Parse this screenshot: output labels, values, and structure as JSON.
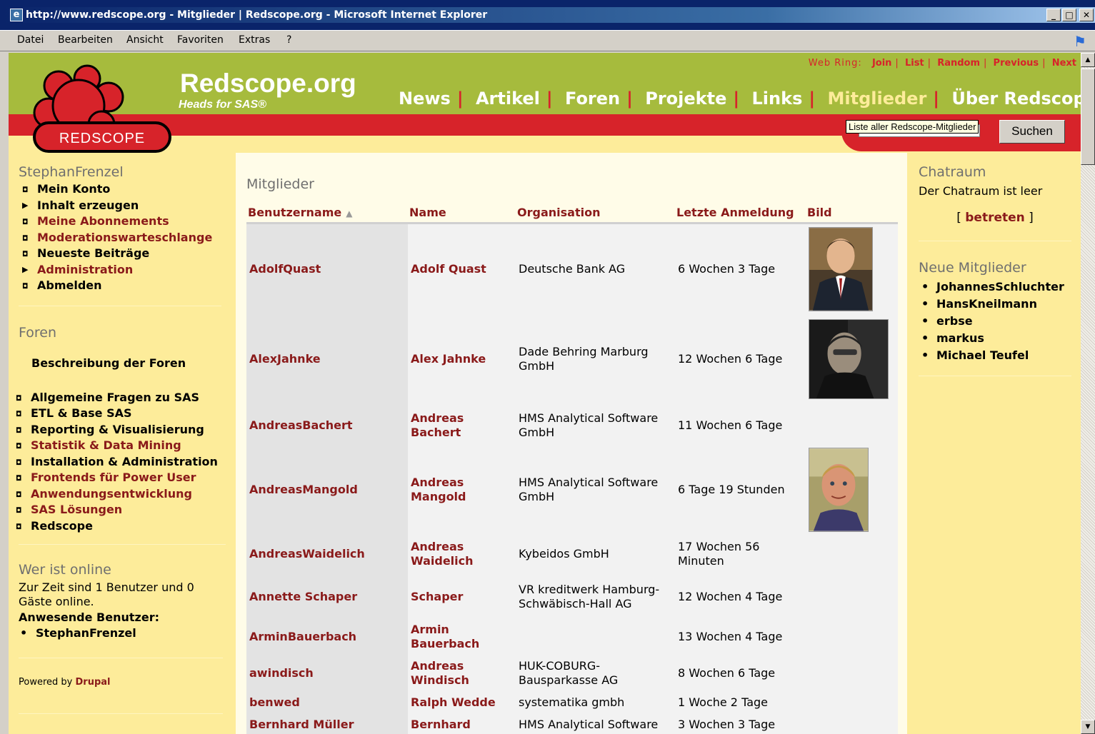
{
  "window": {
    "title": "http://www.redscope.org - Mitglieder | Redscope.org - Microsoft Internet Explorer"
  },
  "menu": {
    "items": [
      "Datei",
      "Bearbeiten",
      "Ansicht",
      "Favoriten",
      "Extras",
      "?"
    ]
  },
  "site": {
    "name": "Redscope.org",
    "slogan": "Heads for SAS®",
    "logo_text": "REDSCOPE"
  },
  "webring": {
    "label": "Web Ring:",
    "links": [
      "Join",
      "List",
      "Random",
      "Previous",
      "Next"
    ]
  },
  "nav": {
    "items": [
      "News",
      "Artikel",
      "Foren",
      "Projekte",
      "Links",
      "Mitglieder",
      "Über Redscope"
    ],
    "active": "Mitglieder"
  },
  "search": {
    "tooltip": "Liste aller Redscope-Mitglieder",
    "button": "Suchen"
  },
  "user_block": {
    "title": "StephanFrenzel",
    "items": [
      {
        "label": "Mein Konto",
        "red": false,
        "bullet": "sq"
      },
      {
        "label": "Inhalt erzeugen",
        "red": false,
        "bullet": "tri"
      },
      {
        "label": "Meine Abonnements",
        "red": true,
        "bullet": "sq"
      },
      {
        "label": "Moderationswarteschlange",
        "red": true,
        "bullet": "sq"
      },
      {
        "label": "Neueste Beiträge",
        "red": false,
        "bullet": "sq"
      },
      {
        "label": "Administration",
        "red": true,
        "bullet": "tri"
      },
      {
        "label": "Abmelden",
        "red": false,
        "bullet": "sq"
      }
    ]
  },
  "forums_block": {
    "title": "Foren",
    "description": "Beschreibung der Foren",
    "items": [
      {
        "label": "Allgemeine Fragen zu SAS",
        "red": false
      },
      {
        "label": "ETL & Base SAS",
        "red": false
      },
      {
        "label": "Reporting & Visualisierung",
        "red": false
      },
      {
        "label": "Statistik & Data Mining",
        "red": true
      },
      {
        "label": "Installation & Administration",
        "red": false
      },
      {
        "label": "Frontends für Power User",
        "red": true
      },
      {
        "label": "Anwendungsentwicklung",
        "red": true
      },
      {
        "label": "SAS Lösungen",
        "red": true
      },
      {
        "label": "Redscope",
        "red": false
      }
    ]
  },
  "online_block": {
    "title": "Wer ist online",
    "text": "Zur Zeit sind 1 Benutzer und 0 Gäste online.",
    "subtitle": "Anwesende Benutzer:",
    "users": [
      "StephanFrenzel"
    ]
  },
  "powered": {
    "text": "Powered by",
    "link": "Drupal"
  },
  "chat_block": {
    "title": "Chatraum",
    "text": "Der Chatraum ist leer",
    "join_open": "[ ",
    "join": "betreten",
    "join_close": " ]"
  },
  "new_members_block": {
    "title": "Neue Mitglieder",
    "items": [
      "JohannesSchluchter",
      "HansKneilmann",
      "erbse",
      "markus",
      "Michael Teufel"
    ]
  },
  "members": {
    "title": "Mitglieder",
    "columns": [
      "Benutzername",
      "Name",
      "Organisation",
      "Letzte Anmeldung",
      "Bild"
    ],
    "rows": [
      {
        "username": "AdolfQuast",
        "name": "Adolf Quast",
        "org": "Deutsche Bank AG",
        "last": "6 Wochen 3 Tage",
        "photo": "portrait-suit"
      },
      {
        "username": "AlexJahnke",
        "name": "Alex Jahnke",
        "org": "Dade Behring Marburg GmbH",
        "last": "12 Wochen 6 Tage",
        "photo": "portrait-dark"
      },
      {
        "username": "AndreasBachert",
        "name": "Andreas Bachert",
        "org": "HMS Analytical Software GmbH",
        "last": "11 Wochen 6 Tage",
        "photo": ""
      },
      {
        "username": "AndreasMangold",
        "name": "Andreas Mangold",
        "org": "HMS Analytical Software GmbH",
        "last": "6 Tage 19 Stunden",
        "photo": "portrait-outdoor"
      },
      {
        "username": "AndreasWaidelich",
        "name": "Andreas Waidelich",
        "org": "Kybeidos GmbH",
        "last": "17 Wochen 56 Minuten",
        "photo": ""
      },
      {
        "username": "Annette Schaper",
        "name": "Schaper",
        "org": "VR kreditwerk Hamburg-Schwäbisch-Hall AG",
        "last": "12 Wochen 4 Tage",
        "photo": ""
      },
      {
        "username": "ArminBauerbach",
        "name": "Armin Bauerbach",
        "org": "",
        "last": "13 Wochen 4 Tage",
        "photo": ""
      },
      {
        "username": "awindisch",
        "name": "Andreas Windisch",
        "org": "HUK-COBURG-Bausparkasse AG",
        "last": "8 Wochen 6 Tage",
        "photo": ""
      },
      {
        "username": "benwed",
        "name": "Ralph Wedde",
        "org": "systematika gmbh",
        "last": "1 Woche 2 Tage",
        "photo": ""
      },
      {
        "username": "Bernhard Müller",
        "name": "Bernhard",
        "org": "HMS Analytical Software",
        "last": "3 Wochen 3 Tage",
        "photo": ""
      }
    ]
  }
}
